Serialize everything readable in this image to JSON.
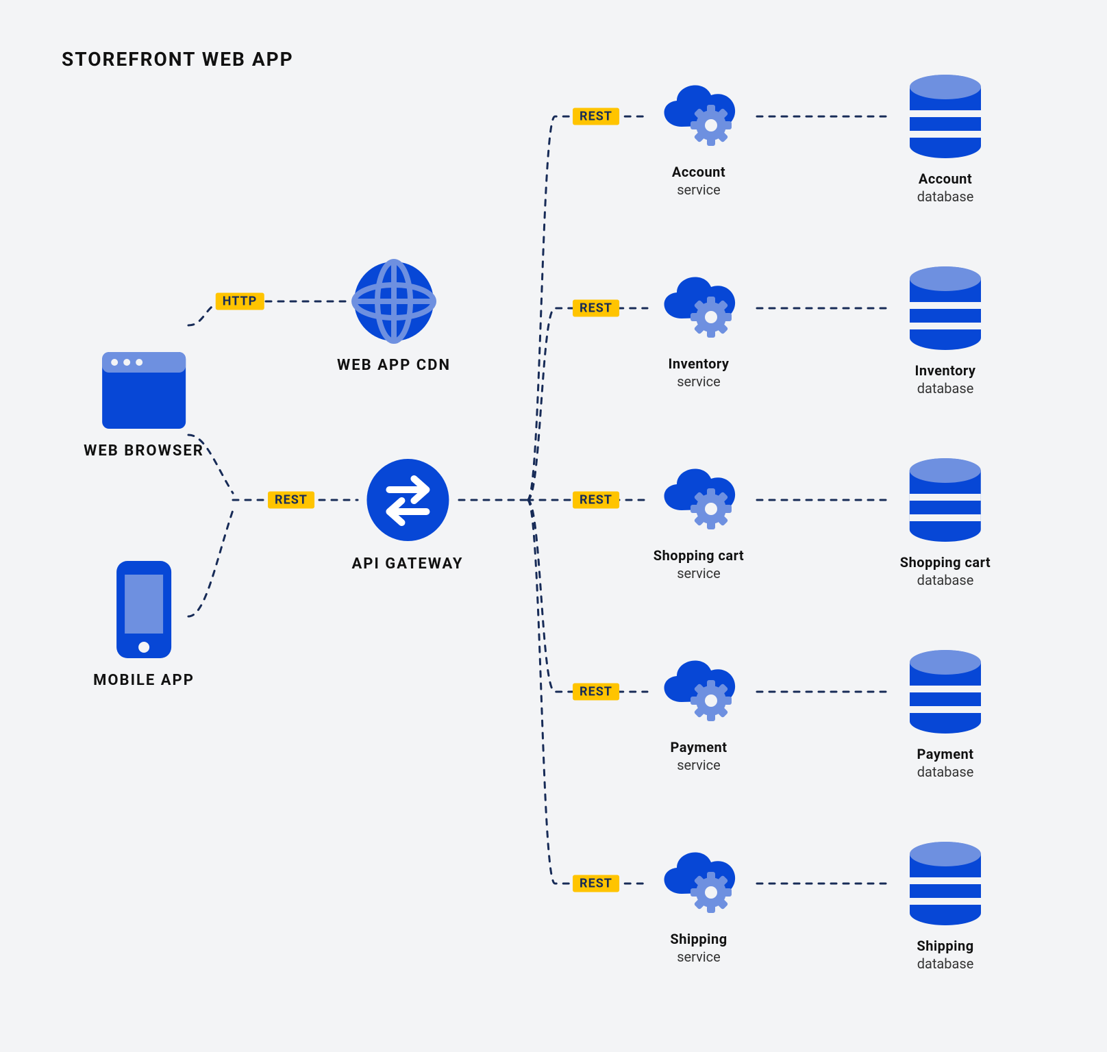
{
  "title": "STOREFRONT WEB APP",
  "colors": {
    "primary": "#0747d6",
    "primary_light": "#6e90e0",
    "badge": "#ffc400",
    "wire": "#172b57"
  },
  "badges": {
    "http": "HTTP",
    "rest": "REST"
  },
  "clients": {
    "web_browser": {
      "label": "WEB BROWSER"
    },
    "mobile_app": {
      "label": "MOBILE APP"
    }
  },
  "middle": {
    "cdn": {
      "label": "WEB APP CDN"
    },
    "gateway": {
      "label": "API GATEWAY"
    }
  },
  "services": [
    {
      "name": "Account",
      "service_sub": "service",
      "db_sub": "database"
    },
    {
      "name": "Inventory",
      "service_sub": "service",
      "db_sub": "database"
    },
    {
      "name": "Shopping cart",
      "service_sub": "service",
      "db_sub": "database"
    },
    {
      "name": "Payment",
      "service_sub": "service",
      "db_sub": "database"
    },
    {
      "name": "Shipping",
      "service_sub": "service",
      "db_sub": "database"
    }
  ]
}
